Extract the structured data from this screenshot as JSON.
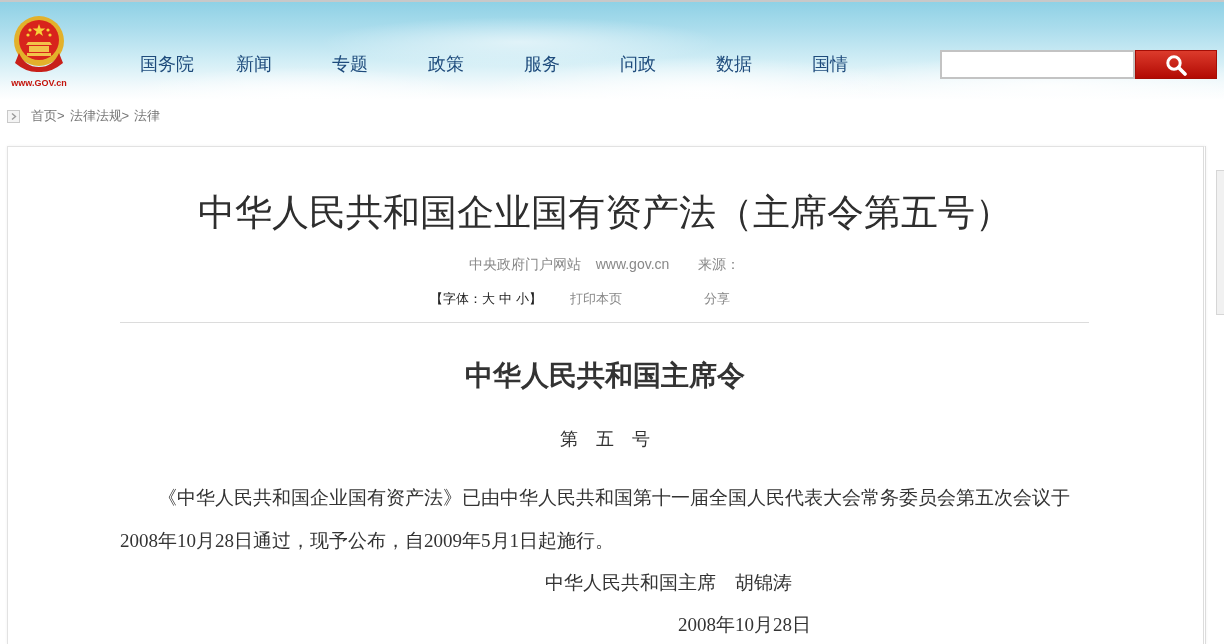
{
  "header": {
    "logo_text": "www.GOV.cn",
    "nav": [
      "国务院",
      "新闻",
      "专题",
      "政策",
      "服务",
      "问政",
      "数据",
      "国情"
    ]
  },
  "breadcrumb": [
    "首页>",
    "法律法规>",
    "法律"
  ],
  "article": {
    "title": "中华人民共和国企业国有资产法（主席令第五号）",
    "meta": {
      "site": "中央政府门户网站",
      "url": "www.gov.cn",
      "source": "来源："
    },
    "tools": {
      "font_prefix": "【字体：",
      "font_options": [
        "大",
        "中",
        "小"
      ],
      "font_suffix": "】",
      "print": "打印本页",
      "share": "分享"
    },
    "heading": "中华人民共和国主席令",
    "number": "第　五　号",
    "paragraph": "《中华人民共和国企业国有资产法》已由中华人民共和国第十一届全国人民代表大会常务委员会第五次会议于2008年10月28日通过，现予公布，自2009年5月1日起施行。",
    "signature": "中华人民共和国主席　胡锦涛",
    "date": "2008年10月28日"
  }
}
